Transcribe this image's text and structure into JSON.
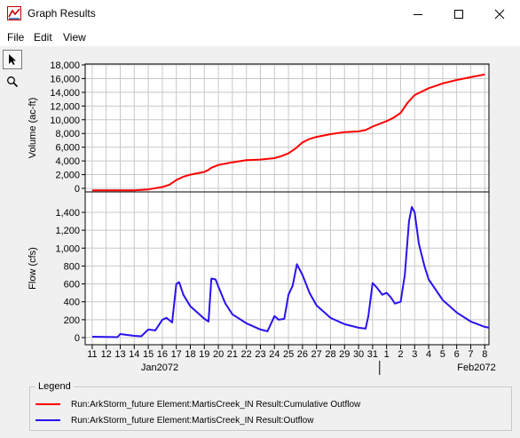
{
  "window": {
    "title": "Graph Results"
  },
  "menu": {
    "file": "File",
    "edit": "Edit",
    "view": "View"
  },
  "toolbar": {
    "pointer_icon": "pointer-arrow-icon",
    "zoom_icon": "magnifier-icon"
  },
  "legend": {
    "title": "Legend",
    "items": [
      {
        "label": "Run:ArkStorm_future Element:MartisCreek_IN Result:Cumulative Outflow",
        "color": "#ff0000"
      },
      {
        "label": "Run:ArkStorm_future Element:MartisCreek_IN Result:Outflow",
        "color": "#2a12f0"
      }
    ]
  },
  "chart_data": [
    {
      "type": "line",
      "ylabel": "Volume (ac-ft)",
      "ylim": [
        0,
        18000
      ],
      "yticks": [
        0,
        2000,
        4000,
        6000,
        8000,
        10000,
        12000,
        14000,
        16000,
        18000
      ],
      "grid": true,
      "series": [
        {
          "name": "Run:ArkStorm_future Element:MartisCreek_IN Result:Cumulative Outflow",
          "color": "#ff0000",
          "points": [
            [
              11,
              -300
            ],
            [
              12,
              -300
            ],
            [
              13,
              -300
            ],
            [
              14,
              -300
            ],
            [
              15,
              -150
            ],
            [
              16,
              200
            ],
            [
              16.5,
              500
            ],
            [
              17,
              1200
            ],
            [
              17.5,
              1700
            ],
            [
              18,
              2000
            ],
            [
              18.5,
              2200
            ],
            [
              19,
              2400
            ],
            [
              19.3,
              2700
            ],
            [
              19.5,
              3000
            ],
            [
              20,
              3400
            ],
            [
              21,
              3800
            ],
            [
              22,
              4100
            ],
            [
              23,
              4200
            ],
            [
              24,
              4400
            ],
            [
              24.5,
              4700
            ],
            [
              25,
              5100
            ],
            [
              25.5,
              5800
            ],
            [
              26,
              6700
            ],
            [
              26.5,
              7200
            ],
            [
              27,
              7500
            ],
            [
              28,
              7900
            ],
            [
              29,
              8200
            ],
            [
              30,
              8300
            ],
            [
              30.5,
              8500
            ],
            [
              31,
              9000
            ],
            [
              32,
              9800
            ],
            [
              32.5,
              10300
            ],
            [
              33,
              11000
            ],
            [
              33.5,
              12500
            ],
            [
              34,
              13600
            ],
            [
              35,
              14600
            ],
            [
              36,
              15300
            ],
            [
              37,
              15800
            ],
            [
              38,
              16200
            ],
            [
              39,
              16600
            ]
          ]
        }
      ]
    },
    {
      "type": "line",
      "ylabel": "Flow (cfs)",
      "ylim": [
        0,
        1500
      ],
      "yticks": [
        0,
        200,
        400,
        600,
        800,
        1000,
        1200,
        1400
      ],
      "grid": true,
      "xlim": [
        10.5,
        39.3
      ],
      "xticks": [
        "11",
        "12",
        "13",
        "14",
        "15",
        "16",
        "17",
        "18",
        "19",
        "20",
        "21",
        "22",
        "23",
        "24",
        "25",
        "26",
        "27",
        "28",
        "29",
        "30",
        "31",
        "1",
        "2",
        "3",
        "4",
        "5",
        "6",
        "7",
        "8"
      ],
      "xgroups": [
        "Jan2072",
        "Feb2072"
      ],
      "series": [
        {
          "name": "Run:ArkStorm_future Element:MartisCreek_IN Result:Outflow",
          "color": "#2a12f0",
          "points": [
            [
              11,
              10
            ],
            [
              12,
              8
            ],
            [
              12.8,
              5
            ],
            [
              13,
              40
            ],
            [
              13.5,
              30
            ],
            [
              14,
              20
            ],
            [
              14.5,
              15
            ],
            [
              15,
              90
            ],
            [
              15.5,
              80
            ],
            [
              16,
              200
            ],
            [
              16.3,
              220
            ],
            [
              16.7,
              170
            ],
            [
              17,
              600
            ],
            [
              17.2,
              620
            ],
            [
              17.5,
              480
            ],
            [
              18,
              350
            ],
            [
              18.5,
              280
            ],
            [
              19,
              210
            ],
            [
              19.3,
              180
            ],
            [
              19.5,
              660
            ],
            [
              19.8,
              650
            ],
            [
              20,
              570
            ],
            [
              20.5,
              380
            ],
            [
              21,
              260
            ],
            [
              22,
              160
            ],
            [
              23,
              90
            ],
            [
              23.5,
              70
            ],
            [
              24,
              240
            ],
            [
              24.3,
              200
            ],
            [
              24.7,
              210
            ],
            [
              25,
              480
            ],
            [
              25.3,
              580
            ],
            [
              25.6,
              820
            ],
            [
              26,
              700
            ],
            [
              26.5,
              500
            ],
            [
              27,
              360
            ],
            [
              28,
              220
            ],
            [
              29,
              150
            ],
            [
              30,
              110
            ],
            [
              30.5,
              100
            ],
            [
              30.7,
              240
            ],
            [
              31,
              610
            ],
            [
              31.3,
              560
            ],
            [
              31.7,
              480
            ],
            [
              32,
              500
            ],
            [
              32.3,
              450
            ],
            [
              32.6,
              380
            ],
            [
              33,
              400
            ],
            [
              33.3,
              700
            ],
            [
              33.6,
              1300
            ],
            [
              33.8,
              1460
            ],
            [
              34,
              1400
            ],
            [
              34.3,
              1050
            ],
            [
              34.7,
              800
            ],
            [
              35,
              650
            ],
            [
              36,
              420
            ],
            [
              37,
              280
            ],
            [
              38,
              180
            ],
            [
              39,
              120
            ],
            [
              39.3,
              110
            ]
          ]
        }
      ]
    }
  ]
}
